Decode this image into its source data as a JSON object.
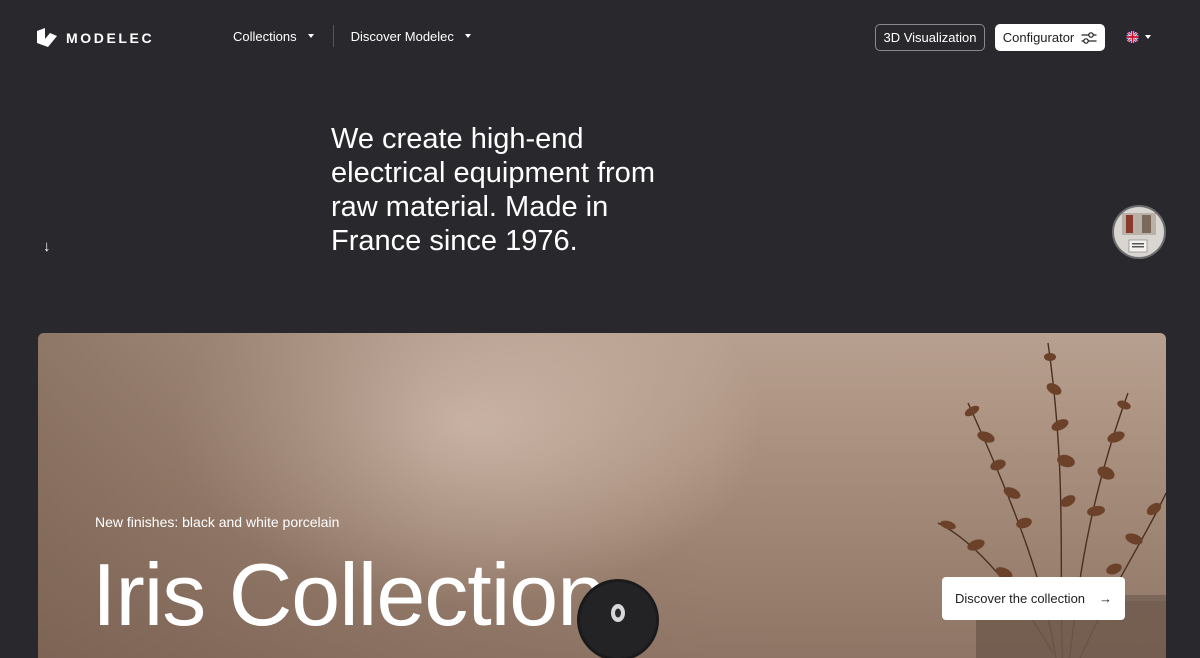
{
  "brand": {
    "name": "MODELEC",
    "logo_icon": "modelec-logo-icon"
  },
  "nav": {
    "items": [
      {
        "label": "Collections",
        "icon": "caret-down-icon"
      },
      {
        "label": "Discover Modelec",
        "icon": "caret-down-icon"
      }
    ]
  },
  "header_actions": {
    "visualization_label": "3D Visualization",
    "configurator_label": "Configurator",
    "configurator_icon": "sliders-icon",
    "language_icon": "uk-flag-icon"
  },
  "intro": {
    "headline": "We create high-end electrical equipment from raw material. Made in France since 1976.",
    "scroll_glyph": "↓"
  },
  "hero": {
    "subtitle": "New finishes: black and white porcelain",
    "title": "Iris Collection",
    "cta_label": "Discover the collection",
    "cta_glyph": "→"
  },
  "colors": {
    "background": "#29292d",
    "text": "#ffffff",
    "button_white": "#ffffff",
    "button_text": "#1e1e21"
  }
}
